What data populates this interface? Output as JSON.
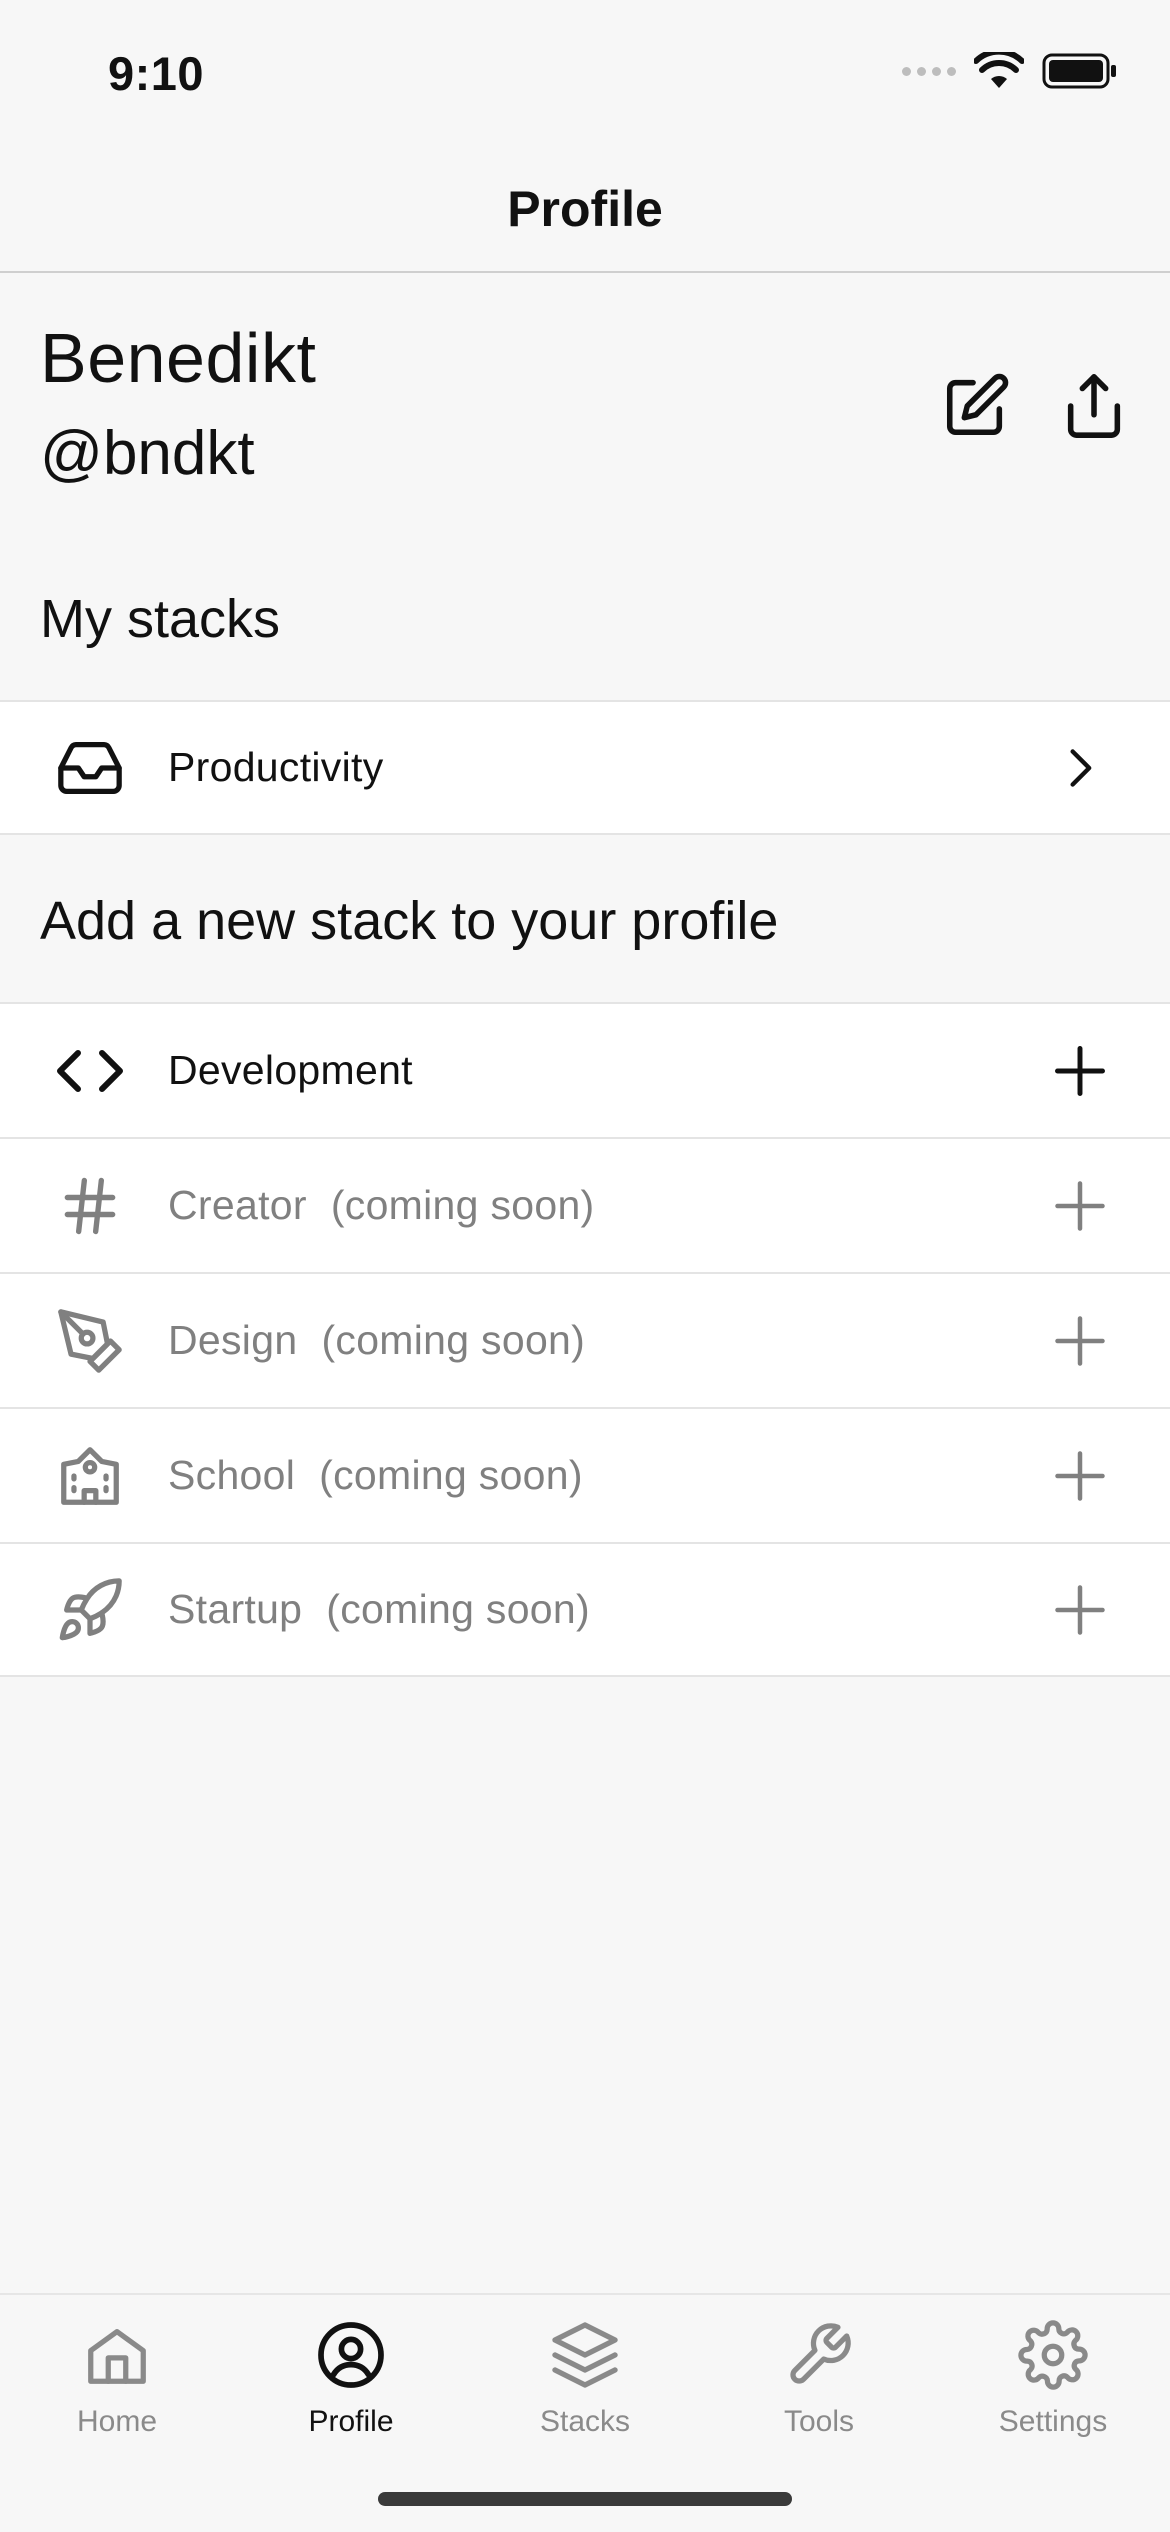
{
  "status_bar": {
    "time": "9:10"
  },
  "nav": {
    "title": "Profile"
  },
  "profile": {
    "name": "Benedikt",
    "handle": "@bndkt",
    "actions": [
      {
        "icon": "edit-icon"
      },
      {
        "icon": "share-icon"
      }
    ]
  },
  "my_stacks": {
    "title": "My stacks",
    "items": [
      {
        "label": "Productivity",
        "icon": "inbox-icon",
        "trailing_icon": "chevron-right-icon"
      }
    ]
  },
  "add_stack": {
    "title": "Add a new stack to your profile",
    "items": [
      {
        "label": "Development",
        "suffix": "",
        "icon": "code-icon",
        "enabled": true
      },
      {
        "label": "Creator",
        "suffix": "(coming soon)",
        "icon": "hash-icon",
        "enabled": false
      },
      {
        "label": "Design",
        "suffix": "(coming soon)",
        "icon": "pen-tool-icon",
        "enabled": false
      },
      {
        "label": "School",
        "suffix": "(coming soon)",
        "icon": "school-icon",
        "enabled": false
      },
      {
        "label": "Startup",
        "suffix": "(coming soon)",
        "icon": "rocket-icon",
        "enabled": false
      }
    ]
  },
  "tab_bar": {
    "tabs": [
      {
        "label": "Home",
        "icon": "home-icon",
        "active": false
      },
      {
        "label": "Profile",
        "icon": "user-circle-icon",
        "active": true
      },
      {
        "label": "Stacks",
        "icon": "stack-icon",
        "active": false
      },
      {
        "label": "Tools",
        "icon": "wrench-icon",
        "active": false
      },
      {
        "label": "Settings",
        "icon": "gear-icon",
        "active": false
      }
    ]
  },
  "colors": {
    "active": "#111111",
    "muted": "#808080",
    "background": "#f7f7f7"
  }
}
